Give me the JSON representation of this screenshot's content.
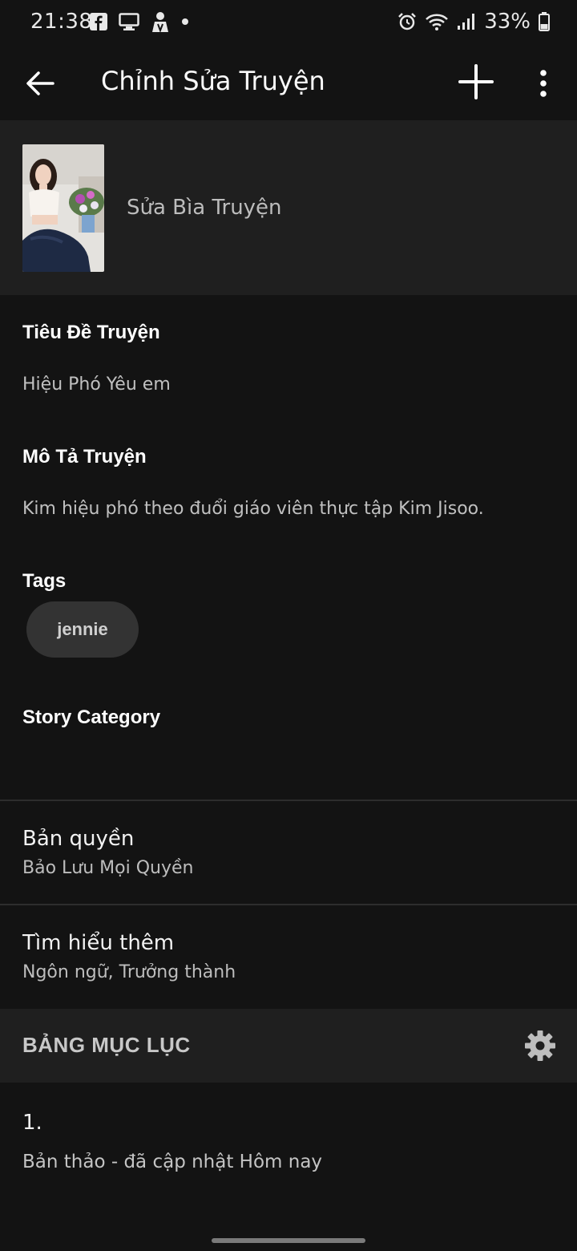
{
  "status_bar": {
    "time": "21:38",
    "notification_icons": [
      "facebook-icon",
      "screen-cast-icon",
      "user-icon",
      "dot-icon"
    ],
    "right_icons": [
      "alarm-icon",
      "wifi-icon",
      "signal-icon",
      "battery-icon"
    ],
    "battery": "33%"
  },
  "app_bar": {
    "title": "Chỉnh Sửa Truyện"
  },
  "cover": {
    "label": "Sửa Bìa Truyện"
  },
  "details": {
    "title_label": "Tiêu Đề Truyện",
    "title_value": "Hiệu Phó Yêu em",
    "description_label": "Mô Tả Truyện",
    "description_value": "Kim hiệu phó theo đuổi giáo viên thực tập Kim Jisoo.",
    "tags_label": "Tags",
    "tags": [
      "jennie"
    ],
    "category_label": "Story Category"
  },
  "copyright": {
    "title": "Bản quyền",
    "value": "Bảo Lưu Mọi Quyền"
  },
  "learn_more": {
    "title": "Tìm hiểu thêm",
    "value": "Ngôn ngữ, Trưởng thành"
  },
  "toc": {
    "header": "BẢNG MỤC LỤC",
    "parts": [
      {
        "number": "1.",
        "status": "Bản thảo - đã cập nhật Hôm nay"
      }
    ]
  },
  "colors": {
    "background": "#131313",
    "section_background": "#1f1f1f",
    "pill_background": "#333333"
  }
}
